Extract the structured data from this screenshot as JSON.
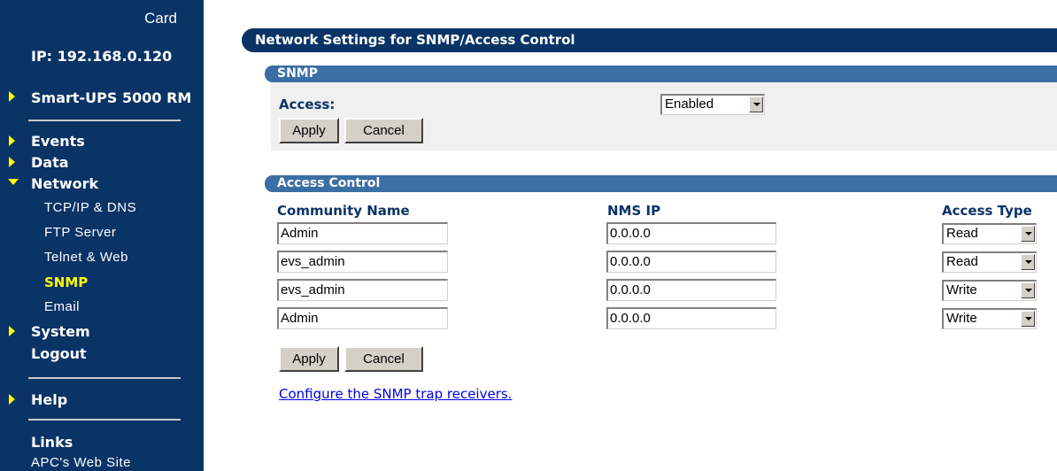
{
  "sidebar": {
    "card_label": "Card",
    "ip_text": "IP: 192.168.0.120",
    "device_name": "Smart-UPS 5000 RM",
    "nav": {
      "events": "Events",
      "data": "Data",
      "network": "Network",
      "network_sub": [
        "TCP/IP & DNS",
        "FTP Server",
        "Telnet & Web",
        "SNMP",
        "Email"
      ],
      "system": "System",
      "logout": "Logout",
      "help": "Help",
      "links": "Links",
      "links_sub": "APC's Web Site"
    }
  },
  "page": {
    "title": "Network Settings for SNMP/Access Control",
    "snmp": {
      "header": "SNMP",
      "access_label": "Access:",
      "access_value": "Enabled",
      "apply_label": "Apply",
      "cancel_label": "Cancel"
    },
    "access_control": {
      "header": "Access Control",
      "columns": [
        "Community Name",
        "NMS IP",
        "Access Type"
      ],
      "rows": [
        {
          "community": "Admin",
          "nms_ip": "0.0.0.0",
          "access": "Read"
        },
        {
          "community": "evs_admin",
          "nms_ip": "0.0.0.0",
          "access": "Read"
        },
        {
          "community": "evs_admin",
          "nms_ip": "0.0.0.0",
          "access": "Write"
        },
        {
          "community": "Admin",
          "nms_ip": "0.0.0.0",
          "access": "Write"
        }
      ],
      "apply_label": "Apply",
      "cancel_label": "Cancel"
    },
    "trap_link": "Configure the SNMP trap receivers."
  },
  "colors": {
    "sidebar_bg": "#0a3366",
    "section_header": "#3b6ea5",
    "active_nav": "#ffff00",
    "link": "#0000ee"
  }
}
